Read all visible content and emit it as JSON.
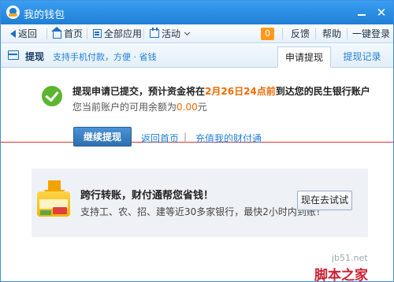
{
  "titlebar": {
    "title": "我的钱包",
    "min_glyph": "",
    "close_glyph": "✕"
  },
  "toolbar": {
    "back": "返回",
    "home": "首页",
    "all_apps": "全部应用",
    "activity": "活动",
    "badge_count": "0",
    "feedback": "反馈",
    "help": "帮助",
    "one_click_login": "一键登录"
  },
  "tabbar": {
    "section_title": "提现",
    "section_subtitle": "支持手机付款，方便 · 省钱",
    "tabs": [
      {
        "label": "申请提现",
        "active": true
      },
      {
        "label": "提现记录",
        "active": false
      }
    ]
  },
  "result": {
    "msg_prefix": "提现申请已提交，预计资金将在",
    "msg_date": "2月26日24点前",
    "msg_suffix": "到达您的民生银行账户",
    "balance_prefix": "您当前账户的可用余额为",
    "balance_value": "0.00",
    "balance_unit": "元"
  },
  "actions": {
    "continue_button": "继续提现",
    "back_home_link": "返回首页",
    "separator": "|",
    "recharge_link": "充值我的财付通"
  },
  "promo": {
    "title": "跨行转账，财付通帮您省钱！",
    "description": "支持工、农、招、建等近30多家银行，最快2小时内到账！",
    "button": "现在去试试"
  },
  "watermark": {
    "line1": "jb51.net",
    "line2": "脚本之家"
  },
  "colors": {
    "accent_blue": "#1f7fd6",
    "highlight_orange": "#f06a00",
    "success_green": "#5cb531"
  }
}
